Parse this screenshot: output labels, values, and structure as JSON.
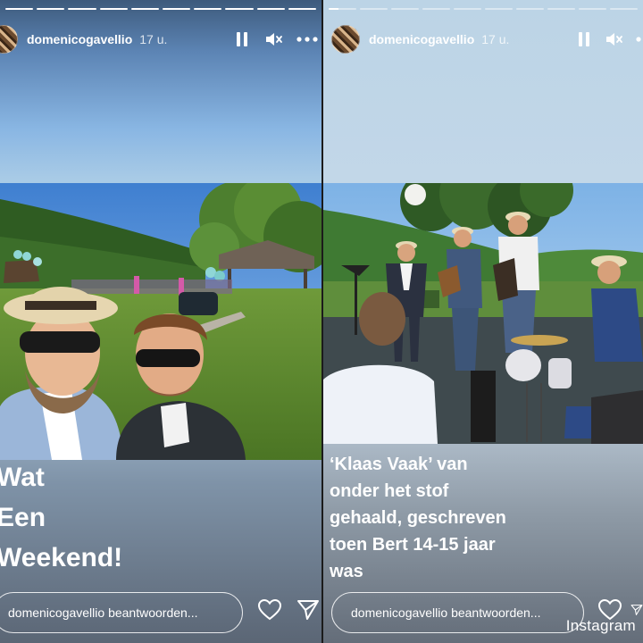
{
  "stories": [
    {
      "username": "domenicogavellio",
      "time": "17 u.",
      "progress": [
        1.0,
        1.0,
        1.0,
        1.0,
        1.0,
        1.0,
        1.0,
        1.0,
        1.0,
        1.0
      ],
      "caption_lines": [
        "Wat",
        "Een",
        "Weekend!"
      ],
      "reply_placeholder": "domenicogavellio beantwoorden...",
      "icons": [
        "pause-icon",
        "mute-icon",
        "more-icon",
        "heart-icon",
        "send-icon"
      ]
    },
    {
      "username": "domenicogavellio",
      "time": "17 u.",
      "progress": [
        0.35,
        0.0,
        0.0,
        0.0,
        0.0,
        0.0,
        0.0,
        0.0,
        0.0,
        0.0
      ],
      "caption_lines": [
        "‘Klaas Vaak’ van",
        "onder het stof",
        "gehaald, geschreven",
        "toen Bert 14-15 jaar",
        "was"
      ],
      "reply_placeholder": "domenicogavellio beantwoorden...",
      "icons": [
        "pause-icon",
        "mute-icon",
        "more-icon",
        "heart-icon",
        "send-icon"
      ]
    }
  ],
  "watermark": "Instagram"
}
